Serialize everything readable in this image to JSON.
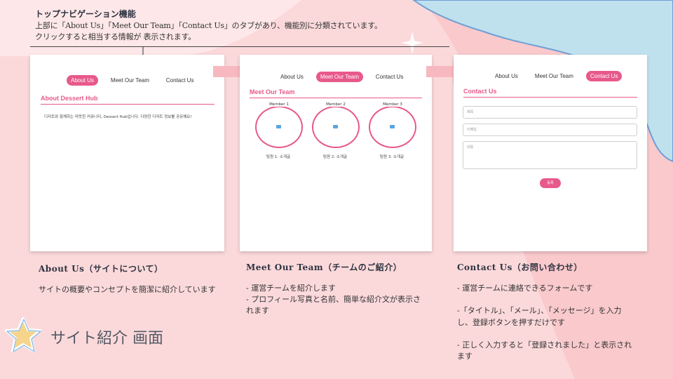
{
  "note": {
    "title": "トップナビゲーション機能",
    "line1": "上部に「About Us」「Meet Our Team」「Contact Us」のタブがあり、機能別に分類されています。",
    "line2": "クリックすると相当する情報が 表示されます。"
  },
  "nav": {
    "about": "About Us",
    "team": "Meet Our Team",
    "contact": "Contact Us"
  },
  "panel_about": {
    "title": "About Dessert Hub",
    "text": "디저트와 함께하는 따뜻한 커뮤니티, Dessert Hub입니다. 다양한 디저트 정보를 공유해요!"
  },
  "panel_team": {
    "title": "Meet Our Team",
    "members": [
      {
        "label": "Member 1",
        "caption": "팀원 1: 소개글"
      },
      {
        "label": "Member 2",
        "caption": "팀원 2: 소개글"
      },
      {
        "label": "Member 3",
        "caption": "팀원 3: 소개글"
      }
    ]
  },
  "panel_contact": {
    "title": "Contact Us",
    "name_placeholder": "제목",
    "email_placeholder": "이메일",
    "message_placeholder": "내용",
    "submit": "등록"
  },
  "columns": {
    "about": {
      "title": "About Us（サイトについて）",
      "body": "サイトの概要やコンセプトを簡潔に紹介しています"
    },
    "team": {
      "title": "Meet Our Team（チームのご紹介）",
      "line1": "- 運営チームを紹介します",
      "line2": "- プロフィール写真と名前、簡単な紹介文が表示さ",
      "line3": "れます"
    },
    "contact": {
      "title": "Contact Us（お問い合わせ）",
      "line1": "- 運営チームに連絡できるフォームです",
      "line2": "-「タイトル」、「メール」、「メッセージ」を入力",
      "line3": "し、登録ボタンを押すだけです",
      "line4": "- 正しく入力すると「登録されました」と表示され",
      "line5": "ます"
    }
  },
  "footer": {
    "title": "サイト紹介 画面"
  },
  "colors": {
    "accent": "#e8598b",
    "background": "#f9c9cc",
    "blue_blob": "#bfe1ee"
  }
}
